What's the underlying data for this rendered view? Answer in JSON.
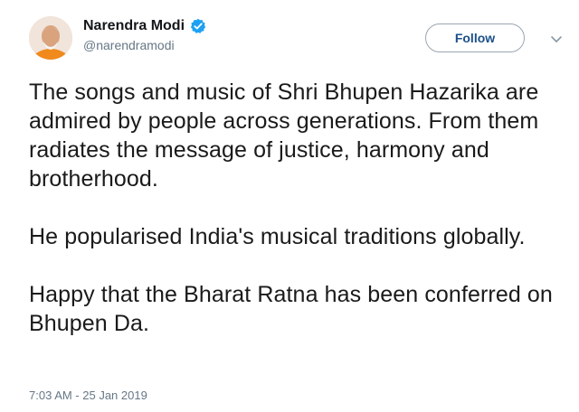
{
  "author": {
    "display_name": "Narendra Modi",
    "handle": "@narendramodi",
    "verified": true,
    "verified_icon": "verified-badge-icon",
    "verified_color": "#1da1f2"
  },
  "actions": {
    "follow_label": "Follow",
    "menu_icon": "chevron-down-icon"
  },
  "tweet": {
    "paragraphs": [
      "The songs and music of Shri Bhupen Hazarika are admired by people across generations. From them radiates the message of justice, harmony and brotherhood.",
      "He popularised India's musical traditions globally.",
      "Happy that the Bharat Ratna has been conferred on Bhupen Da."
    ],
    "timestamp": "7:03 AM - 25 Jan 2019"
  },
  "colors": {
    "text": "#14171a",
    "secondary": "#657786",
    "follow_text": "#1b4f8a"
  }
}
